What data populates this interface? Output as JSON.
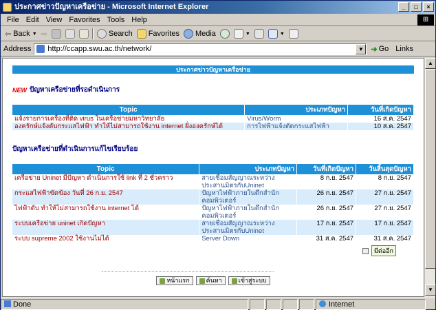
{
  "window": {
    "title": "ประกาศข่าวปัญหาเครือข่าย - Microsoft Internet Explorer",
    "controls": [
      "_",
      "□",
      "×"
    ]
  },
  "menu": [
    "File",
    "Edit",
    "View",
    "Favorites",
    "Tools",
    "Help"
  ],
  "toolbar": {
    "back": "Back",
    "search": "Search",
    "favorites": "Favorites",
    "media": "Media"
  },
  "address": {
    "label": "Address",
    "url": "http://ccapp.swu.ac.th/network/",
    "go": "Go",
    "links": "Links"
  },
  "page": {
    "banner": "ประกาศข่าวปัญหาเครือข่าย",
    "new_badge": "NEW",
    "section1_title": "ปัญหาเครือข่ายที่รอดำเนินการ",
    "section2_title": "ปัญหาเครือข่ายที่ดำเนินการแก้ไขเรียบร้อย",
    "table1": {
      "headers": [
        "Topic",
        "ประเภทปัญหา",
        "วันที่เกิดปัญหา"
      ],
      "rows": [
        [
          "แจ้งรายการเครื่องที่ติด virus ในเครือข่ายมหาวิทยาลัย",
          "Virus/Worm",
          "16 ส.ค. 2547"
        ],
        [
          "องครักษ์แจ้งดับกระแสไฟฟ้า ทำให้ไม่สามารถใช้งาน internet ฝั่งองครักษ์ได้",
          "การไฟฟ้าแจ้งตัดกระแสไฟฟ้า",
          "10 ส.ค. 2547"
        ]
      ]
    },
    "table2": {
      "headers": [
        "Topic",
        "ประเภทปัญหา",
        "วันที่เกิดปัญหา",
        "วันสิ้นสุดปัญหา"
      ],
      "rows": [
        [
          "เครือข่าย Uninet มีปัญหา ดำเนินการใช้ link ที่ 2 ชั่วคราว",
          "สายเชื่อมสัญญาณระหว่างประสานมิตรกับUninet",
          "8 ก.ย. 2547",
          "8 ก.ย. 2547"
        ],
        [
          "กระแสไฟฟ้าขัดข้อง วันที่ 26 ก.ย. 2547",
          "ปัญหาไฟฟ้าภายในตึกสำนักคอมพิวเตอร์",
          "26 ก.ย. 2547",
          "27 ก.ย. 2547"
        ],
        [
          "ไฟฟ้าดับ ทำให้ไม่สามารถใช้งาน internet ได้",
          "ปัญหาไฟฟ้าภายในตึกสำนักคอมพิวเตอร์",
          "26 ก.ย. 2547",
          "27 ก.ย. 2547"
        ],
        [
          "ระบบเครือข่าย uninet เกิดปัญหา",
          "สายเชื่อมสัญญาณระหว่างประสานมิตรกับUninet",
          "17 ก.ย. 2547",
          "17 ก.ย. 2547"
        ],
        [
          "ระบบ supreme 2002 ใช้งานไม่ได้",
          "Server Down",
          "31 ส.ค. 2547",
          "31 ส.ค. 2547"
        ]
      ]
    },
    "more_button": "มีต่ออีก",
    "nav_buttons": [
      "หน้าแรก",
      "ค้นหา",
      "เข้าสู่ระบบ"
    ]
  },
  "status": {
    "left": "Done",
    "zone": "Internet"
  }
}
